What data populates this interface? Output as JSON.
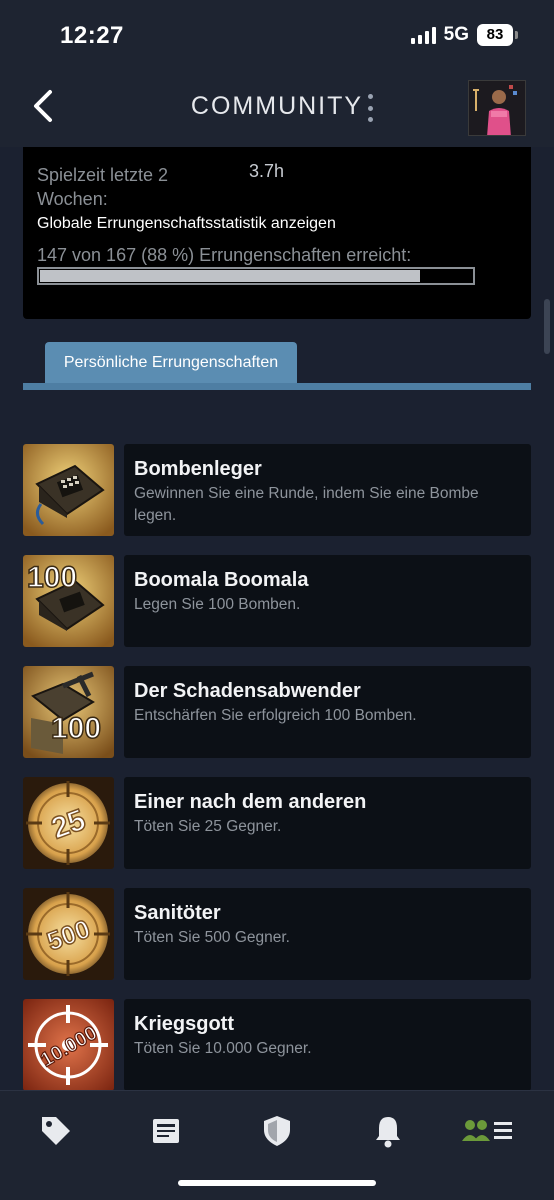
{
  "status_bar": {
    "time": "12:27",
    "network": "5G",
    "battery": "83"
  },
  "header": {
    "title": "COMMUNITY"
  },
  "stats": {
    "playtime_label": "Spielzeit letzte 2 Wochen:",
    "playtime_value": "3.7h",
    "global_link": "Globale Errungenschaftsstatistik anzeigen",
    "progress_text": "147 von 167 (88 %) Errungenschaften erreicht:",
    "progress_fraction": 0.88
  },
  "tabs": [
    {
      "label": "Persönliche Errungenschaften"
    }
  ],
  "achievements": [
    {
      "name": "Bombenleger",
      "description": "Gewinnen Sie eine Runde, indem Sie eine Bombe legen.",
      "icon": "bomb-icon"
    },
    {
      "name": "Boomala Boomala",
      "description": "Legen Sie 100 Bomben.",
      "icon": "bomb-100-icon",
      "badge": "100"
    },
    {
      "name": "Der Schadensabwender",
      "description": "Entschärfen Sie erfolgreich 100 Bomben.",
      "icon": "defuse-100-icon",
      "badge": "100"
    },
    {
      "name": "Einer nach dem anderen",
      "description": "Töten Sie 25 Gegner.",
      "icon": "crosshair-25-icon",
      "badge": "25"
    },
    {
      "name": "Sanitöter",
      "description": "Töten Sie 500 Gegner.",
      "icon": "crosshair-500-icon",
      "badge": "500"
    },
    {
      "name": "Kriegsgott",
      "description": "Töten Sie 10.000 Gegner.",
      "icon": "crosshair-10000-icon",
      "badge": "10.000"
    }
  ],
  "nav": [
    {
      "icon": "tag-icon"
    },
    {
      "icon": "news-icon"
    },
    {
      "icon": "shield-icon"
    },
    {
      "icon": "bell-icon"
    },
    {
      "icon": "friends-menu-icon"
    }
  ],
  "colors": {
    "background": "#1b2130",
    "tab": "#5b8db2",
    "card": "#0c1016",
    "friends_accent": "#6b9a3a"
  }
}
